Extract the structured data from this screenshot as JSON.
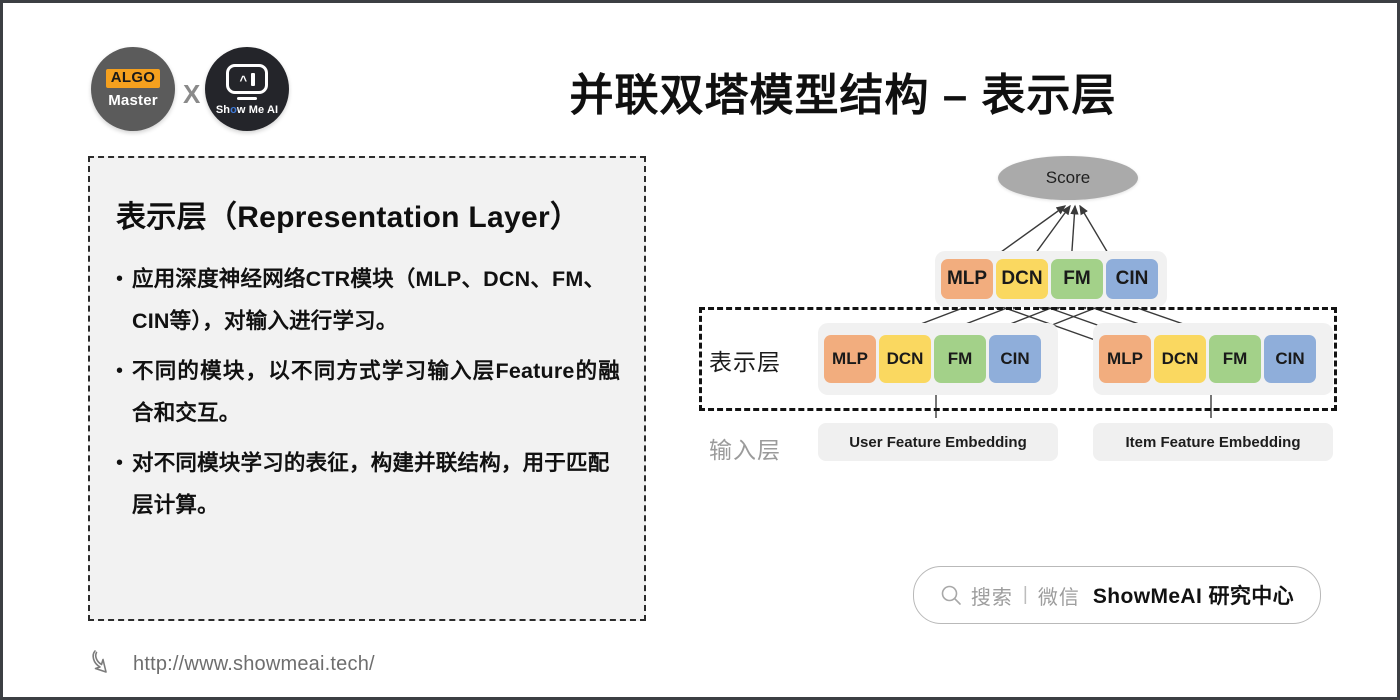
{
  "header": {
    "title": "并联双塔模型结构 – 表示层",
    "logo_left": {
      "badge": "ALGO",
      "name": "Master"
    },
    "logo_separator": "X",
    "logo_right": {
      "name_prefix": "Sh",
      "name_dot": "o",
      "name_suffix": "w Me AI"
    }
  },
  "panel": {
    "heading": "表示层（Representation Layer）",
    "bullet_marker": "•",
    "bullets": [
      "应用深度神经网络CTR模块（MLP、DCN、FM、CIN等），对输入进行学习。",
      "不同的模块，以不同方式学习输入层Feature的融合和交互。",
      "对不同模块学习的表征，构建并联结构，用于匹配层计算。"
    ]
  },
  "diagram": {
    "score_label": "Score",
    "layer_labels": {
      "representation": "表示层",
      "input": "输入层"
    },
    "fusion_modules": [
      {
        "label": "MLP",
        "color": "#f2ad7e"
      },
      {
        "label": "DCN",
        "color": "#fad860"
      },
      {
        "label": "FM",
        "color": "#a3d189"
      },
      {
        "label": "CIN",
        "color": "#8faeda"
      }
    ],
    "towers": [
      {
        "name": "user-tower",
        "embedding_label": "User Feature Embedding",
        "modules": [
          {
            "label": "MLP",
            "color": "#f2ad7e"
          },
          {
            "label": "DCN",
            "color": "#fad860"
          },
          {
            "label": "FM",
            "color": "#a3d189"
          },
          {
            "label": "CIN",
            "color": "#8faeda"
          }
        ]
      },
      {
        "name": "item-tower",
        "embedding_label": "Item Feature Embedding",
        "modules": [
          {
            "label": "MLP",
            "color": "#f2ad7e"
          },
          {
            "label": "DCN",
            "color": "#fad860"
          },
          {
            "label": "FM",
            "color": "#a3d189"
          },
          {
            "label": "CIN",
            "color": "#8faeda"
          }
        ]
      }
    ]
  },
  "search_bar": {
    "placeholder": "搜索",
    "separator": "|",
    "channel": "微信",
    "brand": "ShowMeAI 研究中心"
  },
  "footer": {
    "url": "http://www.showmeai.tech/"
  }
}
